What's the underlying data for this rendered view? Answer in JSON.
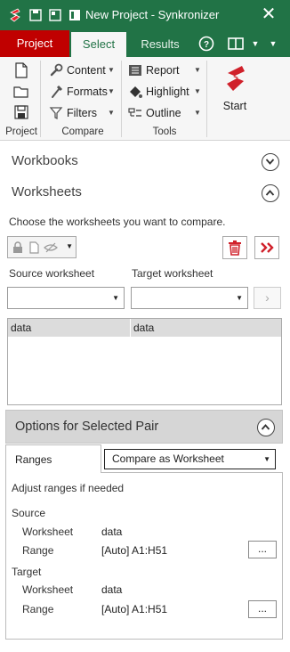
{
  "titlebar": {
    "title": "New Project - Synkronizer",
    "close": "✕"
  },
  "tabs": {
    "project": "Project",
    "select": "Select",
    "results": "Results",
    "help": "?"
  },
  "ribbon": {
    "project_group": "Project",
    "compare_group": "Compare",
    "tools_group": "Tools",
    "content": "Content",
    "formats": "Formats",
    "filters": "Filters",
    "report": "Report",
    "highlight": "Highlight",
    "outline": "Outline",
    "start": "Start"
  },
  "workbooks": {
    "title": "Workbooks"
  },
  "worksheets": {
    "title": "Worksheets",
    "description": "Choose the worksheets you want to compare.",
    "source_label": "Source worksheet",
    "target_label": "Target worksheet",
    "source_value": "",
    "target_value": "",
    "next": "›",
    "pairs": [
      {
        "source": "data",
        "target": "data"
      }
    ]
  },
  "options": {
    "title": "Options for Selected Pair",
    "tab_ranges": "Ranges",
    "mode": "Compare as Worksheet",
    "hint": "Adjust ranges if needed",
    "source": {
      "heading": "Source",
      "worksheet_label": "Worksheet",
      "worksheet": "data",
      "range_label": "Range",
      "range": "[Auto] A1:H51",
      "browse": "..."
    },
    "target": {
      "heading": "Target",
      "worksheet_label": "Worksheet",
      "worksheet": "data",
      "range_label": "Range",
      "range": "[Auto] A1:H51",
      "browse": "..."
    }
  },
  "colors": {
    "brand_green": "#217346",
    "project_red": "#c00000",
    "accent_red": "#d0202a"
  }
}
